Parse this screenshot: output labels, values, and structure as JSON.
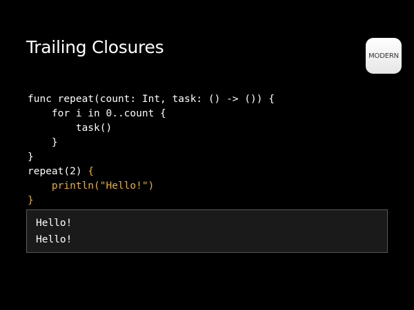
{
  "slide": {
    "title": "Trailing Closures",
    "badge": "MODERN"
  },
  "code": {
    "lines": [
      {
        "text": "func repeat(count: Int, task: () -> ()) {",
        "highlight": false
      },
      {
        "text": "    for i in 0..count {",
        "highlight": false
      },
      {
        "text": "        task()",
        "highlight": false
      },
      {
        "text": "    }",
        "highlight": false
      },
      {
        "text": "}",
        "highlight": false
      },
      {
        "text": "repeat(2) ",
        "highlight": false,
        "suffix": "{"
      },
      {
        "text": "    println(\"Hello!\")",
        "highlight": true
      },
      {
        "text": "}",
        "highlight": true
      }
    ],
    "highlight_color": "#e8b32e"
  },
  "output": {
    "lines": [
      "Hello!",
      "Hello!"
    ]
  }
}
